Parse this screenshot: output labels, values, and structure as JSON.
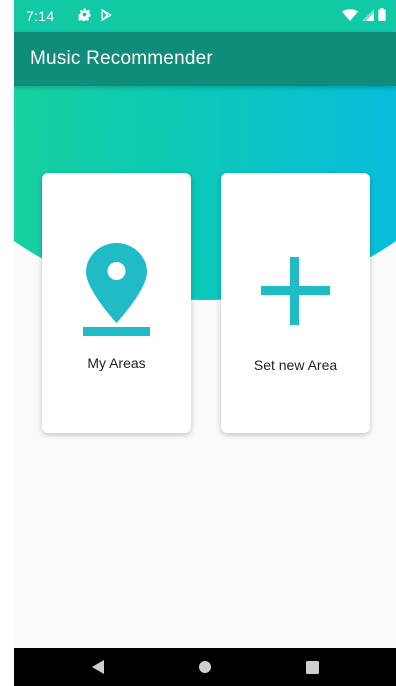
{
  "status_bar": {
    "time": "7:14",
    "icons": [
      "gear-icon",
      "play-store-icon",
      "wifi-icon",
      "signal-icon",
      "battery-icon"
    ]
  },
  "app_bar": {
    "title": "Music Recommender"
  },
  "cards": [
    {
      "label": "My Areas",
      "icon": "location-pin-icon"
    },
    {
      "label": "Set new Area",
      "icon": "plus-icon"
    }
  ],
  "nav_bar": {
    "buttons": [
      "back-icon",
      "home-icon",
      "recents-icon"
    ]
  },
  "colors": {
    "status_bar": "#12c9a6",
    "app_bar": "#0f8d7a",
    "accent": "#1fbcc6",
    "gradient_start": "#1fd690",
    "gradient_end": "#05b8f0"
  }
}
